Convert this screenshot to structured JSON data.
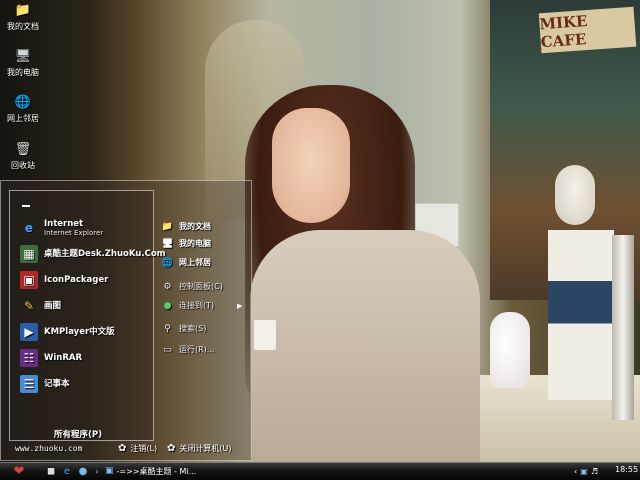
{
  "wallpaper": {
    "sign_text": "MIKE CAFE"
  },
  "desktop_icons": [
    {
      "label": "我的文档",
      "icon": "documents-folder-icon"
    },
    {
      "label": "我的电脑",
      "icon": "computer-icon"
    },
    {
      "label": "网上邻居",
      "icon": "network-icon"
    },
    {
      "label": "回收站",
      "icon": "recycle-bin-icon"
    }
  ],
  "start_menu": {
    "programs": [
      {
        "label": "Internet",
        "sub": "Internet Explorer",
        "icon": "internet-explorer-icon"
      },
      {
        "label": "桌酷主题Desk.ZhuoKu.Com",
        "icon": "theme-icon"
      },
      {
        "label": "IconPackager",
        "icon": "iconpackager-icon"
      },
      {
        "label": "画图",
        "icon": "paint-icon"
      },
      {
        "label": "KMPlayer中文版",
        "icon": "kmplayer-icon"
      },
      {
        "label": "WinRAR",
        "icon": "winrar-icon"
      },
      {
        "label": "记事本",
        "icon": "notepad-icon"
      }
    ],
    "all_programs": "所有程序(P)",
    "places": [
      {
        "label": "我的文档",
        "icon": "documents-icon"
      },
      {
        "label": "我的电脑",
        "icon": "computer-icon"
      },
      {
        "label": "网上邻居",
        "icon": "network-icon"
      },
      {
        "label": "控制面板(C)",
        "icon": "control-panel-icon"
      },
      {
        "label": "连接到(T)",
        "icon": "connect-icon"
      },
      {
        "label": "搜索(S)",
        "icon": "search-icon"
      },
      {
        "label": "运行(R)...",
        "icon": "run-icon"
      }
    ],
    "footer": {
      "url": "www.zhuoku.com",
      "logoff": "注销(L)",
      "shutdown": "关闭计算机(U)"
    }
  },
  "taskbar": {
    "task_item": "-=>>桌酷主题 - Mi...",
    "clock": "18:55"
  },
  "colors": {
    "start_accent": "#e0403a",
    "taskbar": "#0a0a0a"
  }
}
